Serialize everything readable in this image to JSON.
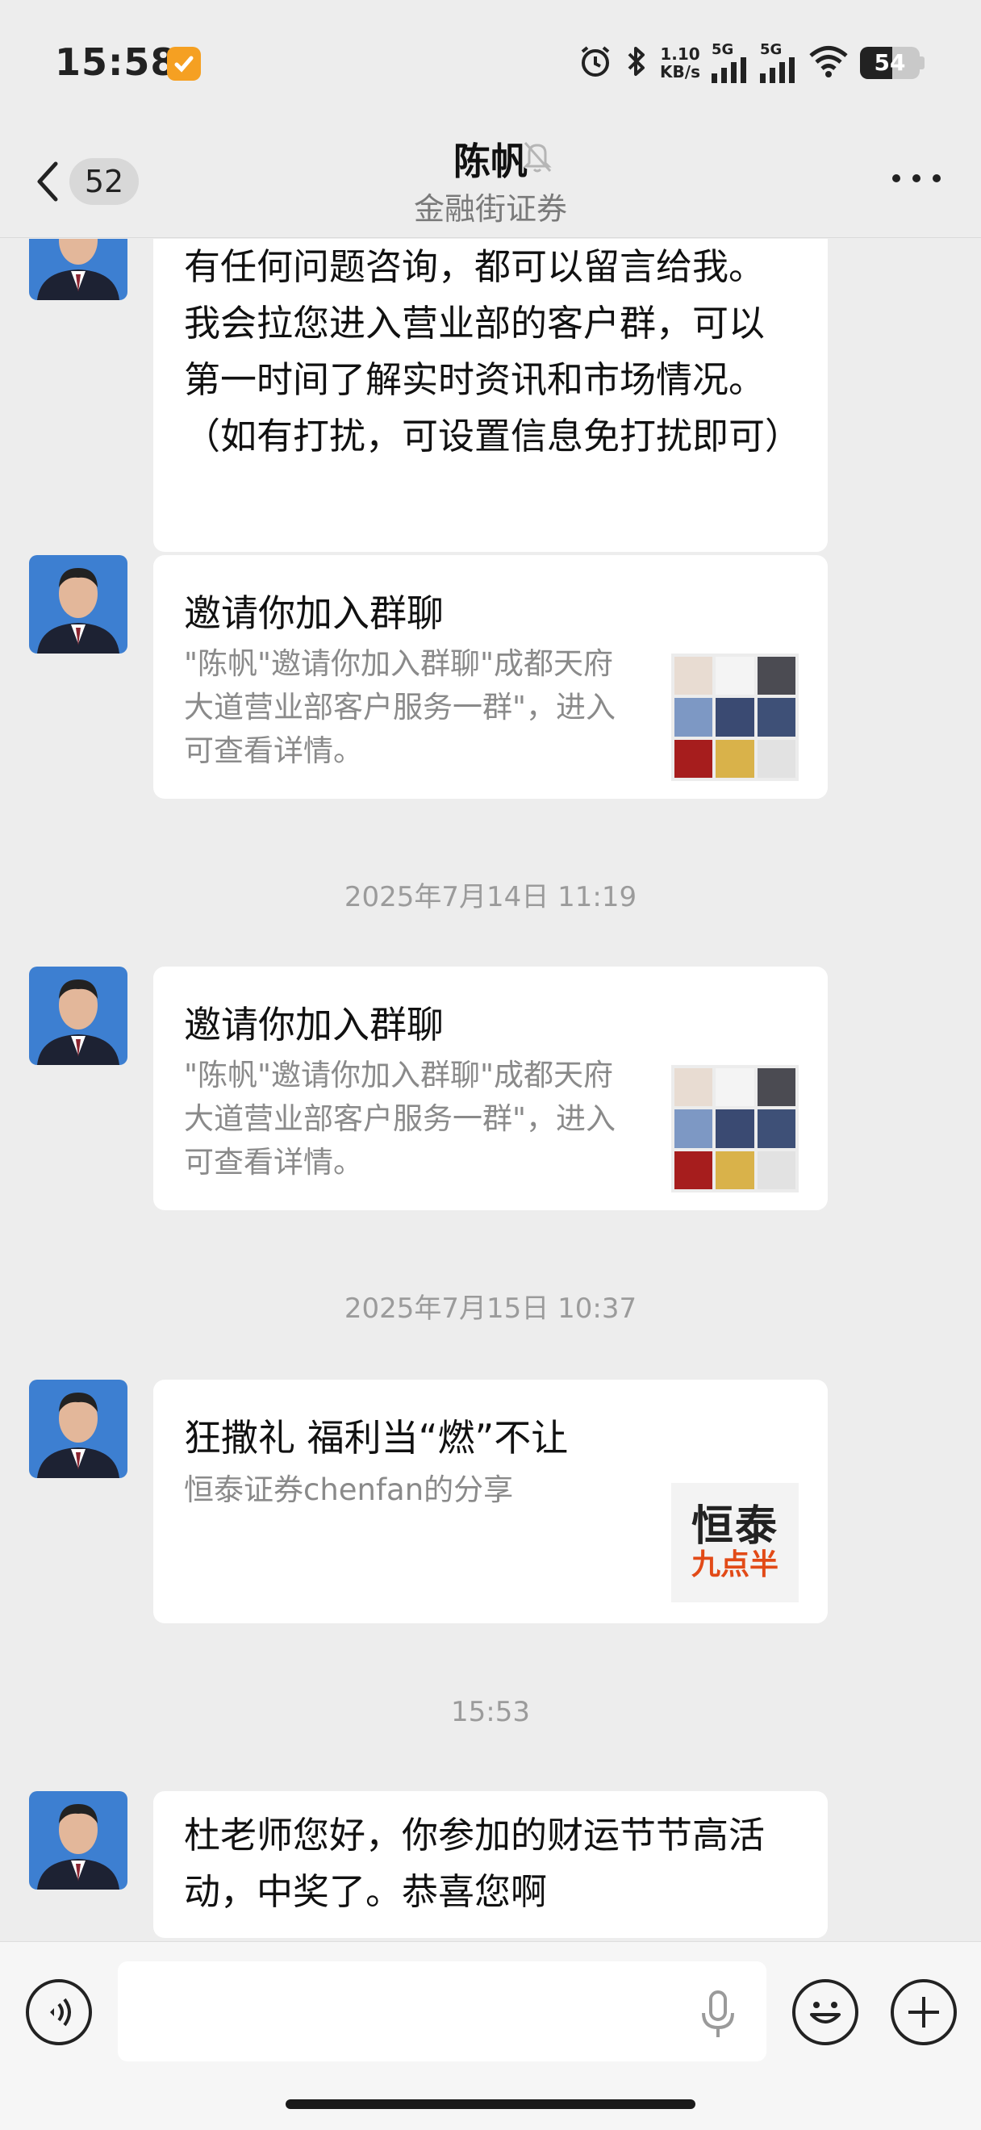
{
  "status_bar": {
    "time": "15:58",
    "net_speed_value": "1.10",
    "net_speed_unit": "KB/s",
    "signal_1_label": "5G",
    "signal_2_label": "5G",
    "battery_level": "54",
    "battery_percent": 54
  },
  "header": {
    "unread_count": "52",
    "title": "陈帆",
    "subtitle": "金融街证券"
  },
  "messages": [
    {
      "type": "text",
      "text": "有任何问题咨询，都可以留言给我。我会拉您进入营业部的客户群，可以第一时间了解实时资讯和市场情况。（如有打扰，可设置信息免打扰即可）"
    },
    {
      "type": "group_invite",
      "title": "邀请你加入群聊",
      "description": "\"陈帆\"邀请你加入群聊\"成都天府大道营业部客户服务一群\"，进入可查看详情。"
    },
    {
      "type": "timestamp",
      "text": "2025年7月14日 11:19"
    },
    {
      "type": "group_invite",
      "title": "邀请你加入群聊",
      "description": "\"陈帆\"邀请你加入群聊\"成都天府大道营业部客户服务一群\"，进入可查看详情。"
    },
    {
      "type": "timestamp",
      "text": "2025年7月15日 10:37"
    },
    {
      "type": "link_share",
      "title": "狂撒礼 福利当“燃”不让",
      "description": "恒泰证券chenfan的分享",
      "logo_main": "恒泰",
      "logo_sub": "九点半"
    },
    {
      "type": "timestamp",
      "text": "15:53"
    },
    {
      "type": "text",
      "text": "杜老师您好，你参加的财运节节高活动，中奖了。恭喜您啊"
    }
  ],
  "input_bar": {
    "placeholder": ""
  },
  "colors": {
    "background": "#ededed",
    "bubble": "#ffffff",
    "avatar": "#3d7fd1",
    "logo_accent": "#e24a17",
    "app_badge": "#f5a022"
  }
}
